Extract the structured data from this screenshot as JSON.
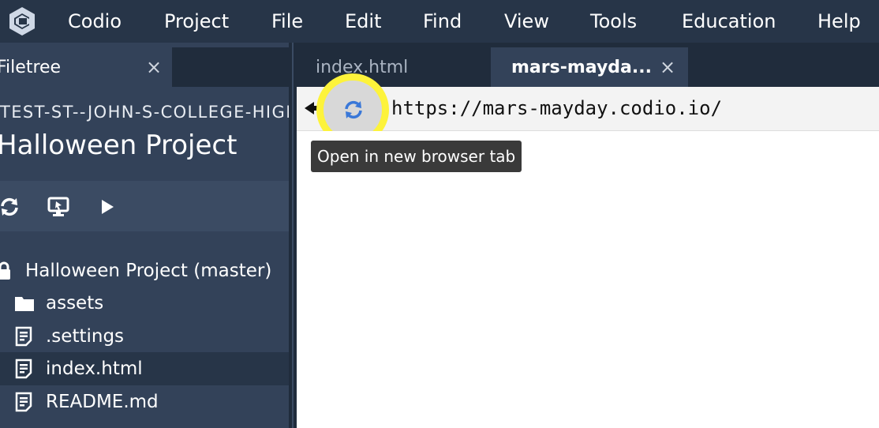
{
  "menu": {
    "items": [
      "Codio",
      "Project",
      "File",
      "Edit",
      "Find",
      "View",
      "Tools",
      "Education",
      "Help"
    ]
  },
  "sidebar": {
    "tab_label": "Filetree",
    "tab_close": "×",
    "box_name": "TEST-ST--JOHN-S-COLLEGE-HIGH",
    "project_title": "Halloween Project",
    "toolbar_icons": [
      "refresh-icon",
      "preview-icon",
      "run-icon"
    ],
    "tree": [
      {
        "label": "Halloween Project (master)",
        "icon": "lock-icon"
      },
      {
        "label": "assets",
        "icon": "folder-icon"
      },
      {
        "label": ".settings",
        "icon": "file-icon"
      },
      {
        "label": "index.html",
        "icon": "file-icon",
        "selected": true
      },
      {
        "label": "README.md",
        "icon": "file-icon"
      }
    ]
  },
  "editor": {
    "tabs": [
      {
        "label": "index.html"
      },
      {
        "label": "mars-mayda...",
        "active": true,
        "close": "×"
      }
    ]
  },
  "browser": {
    "url": "https://mars-mayday.codio.io/",
    "tooltip": "Open in new browser tab"
  },
  "colors": {
    "menubar": "#273548",
    "sidebar": "#334259",
    "highlight": "#fdf33b",
    "refresh_icon": "#3a78d8"
  }
}
